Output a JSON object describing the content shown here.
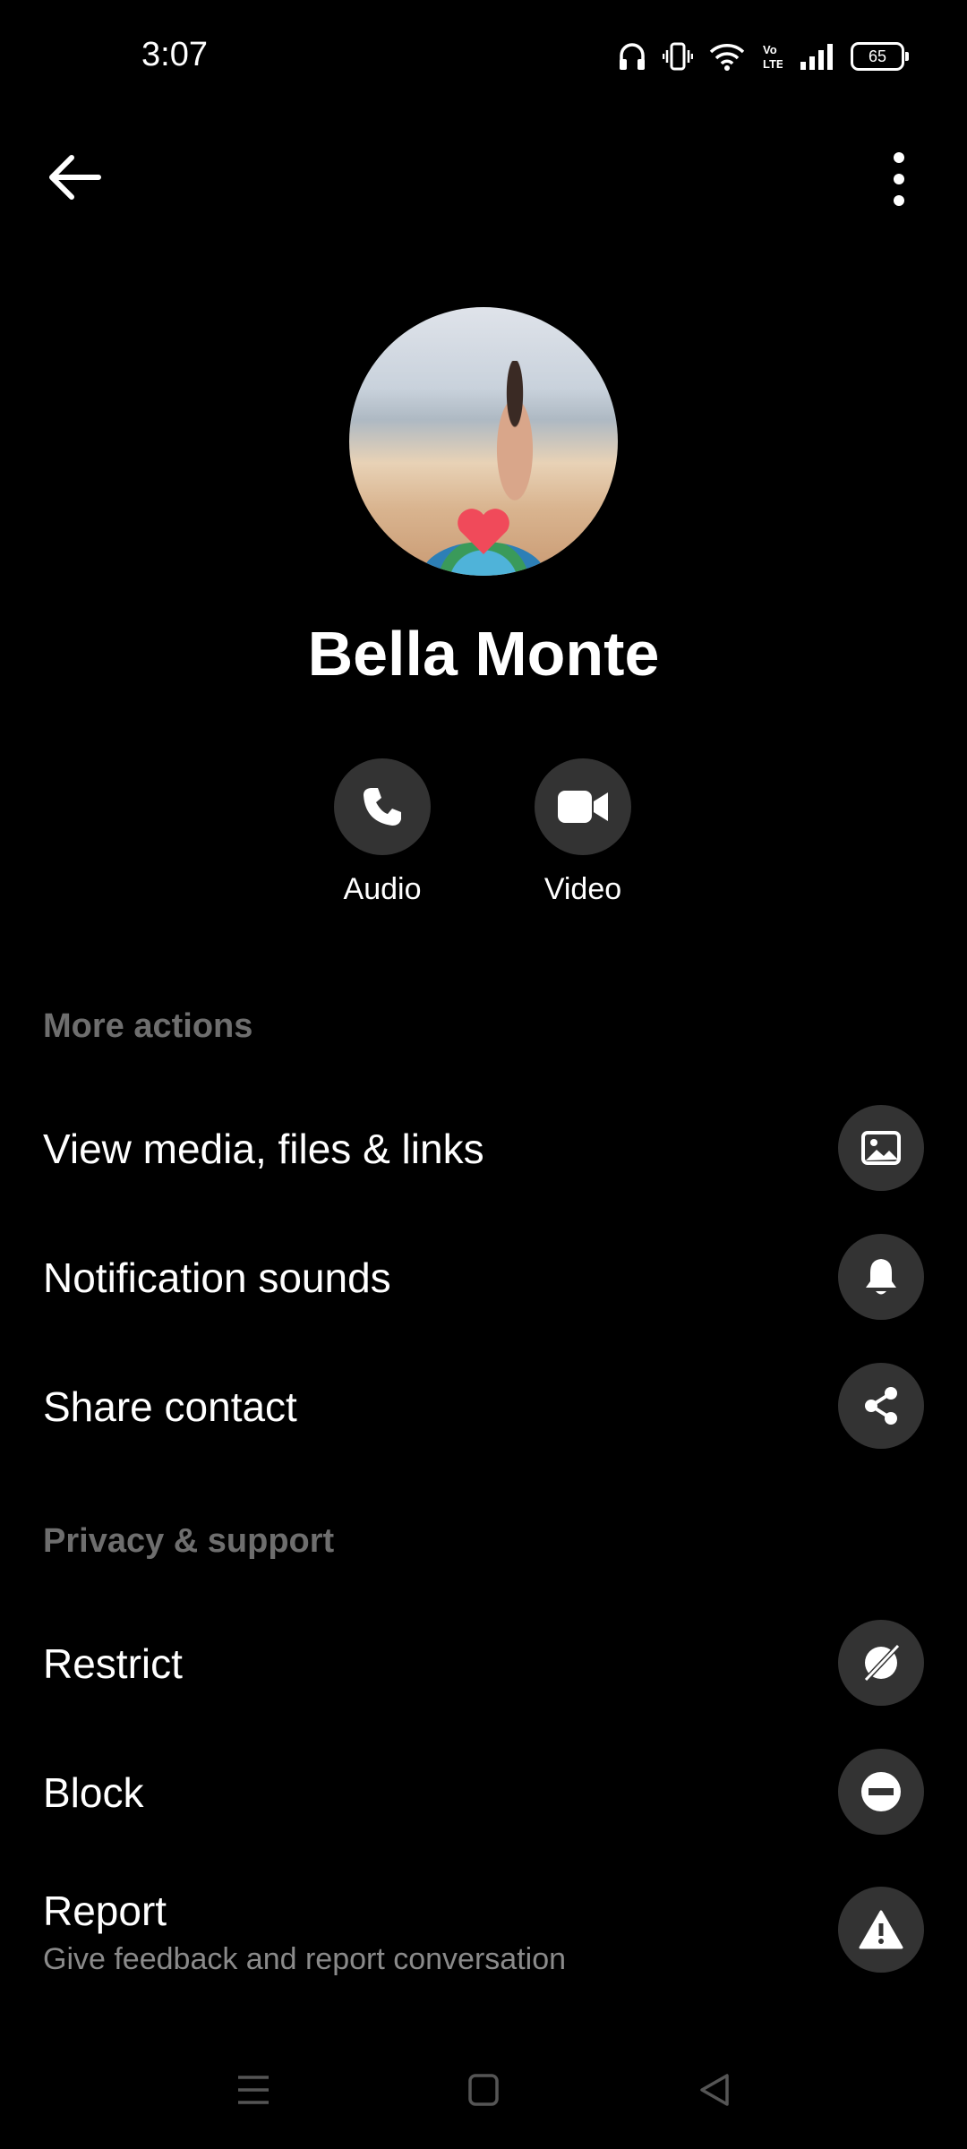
{
  "status_bar": {
    "time": "3:07",
    "battery": "65",
    "icons": [
      "headphones-icon",
      "vibrate-icon",
      "wifi-icon",
      "volte-icon",
      "signal-icon",
      "battery-icon"
    ]
  },
  "header": {
    "back_icon": "arrow-left-icon",
    "more_icon": "more-vertical-icon"
  },
  "profile": {
    "name": "Bella Monte"
  },
  "call_actions": {
    "audio_label": "Audio",
    "video_label": "Video"
  },
  "more_actions": {
    "title": "More actions",
    "items": [
      {
        "label": "View media, files & links",
        "icon": "image-icon"
      },
      {
        "label": "Notification sounds",
        "icon": "bell-icon"
      },
      {
        "label": "Share contact",
        "icon": "share-icon"
      }
    ]
  },
  "privacy_support": {
    "title": "Privacy & support",
    "items": [
      {
        "label": "Restrict",
        "icon": "restrict-icon"
      },
      {
        "label": "Block",
        "icon": "block-icon"
      },
      {
        "label": "Report",
        "sublabel": "Give feedback and report conversation",
        "icon": "warning-icon"
      }
    ]
  },
  "nav_bar": {
    "icons": [
      "menu-icon",
      "home-square-icon",
      "back-triangle-icon"
    ]
  }
}
